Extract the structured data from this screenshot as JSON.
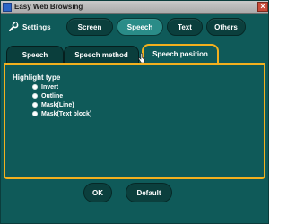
{
  "window": {
    "title": "Easy Web Browsing",
    "close_glyph": "×"
  },
  "settings": {
    "label": "Settings",
    "tabs": [
      {
        "label": "Screen",
        "active": false
      },
      {
        "label": "Speech",
        "active": true
      },
      {
        "label": "Text",
        "active": false
      },
      {
        "label": "Others",
        "active": false
      }
    ]
  },
  "subtabs": [
    {
      "label": "Speech",
      "active": false
    },
    {
      "label": "Speech method",
      "active": false
    },
    {
      "label": "Speech position",
      "active": true
    }
  ],
  "panel": {
    "section_title": "Highlight type",
    "options": [
      "Invert",
      "Outline",
      "Mask(Line)",
      "Mask(Text block)"
    ]
  },
  "buttons": {
    "ok": "OK",
    "default": "Default"
  },
  "colors": {
    "background": "#0f5a59",
    "accent_border": "#f2b01e",
    "dark_button": "#0b3f3d",
    "active_button": "#2a8c88"
  },
  "icons": {
    "settings": "wrench-icon",
    "window": "app-icon",
    "close": "close-icon",
    "cursor": "hand-pointer-icon"
  }
}
